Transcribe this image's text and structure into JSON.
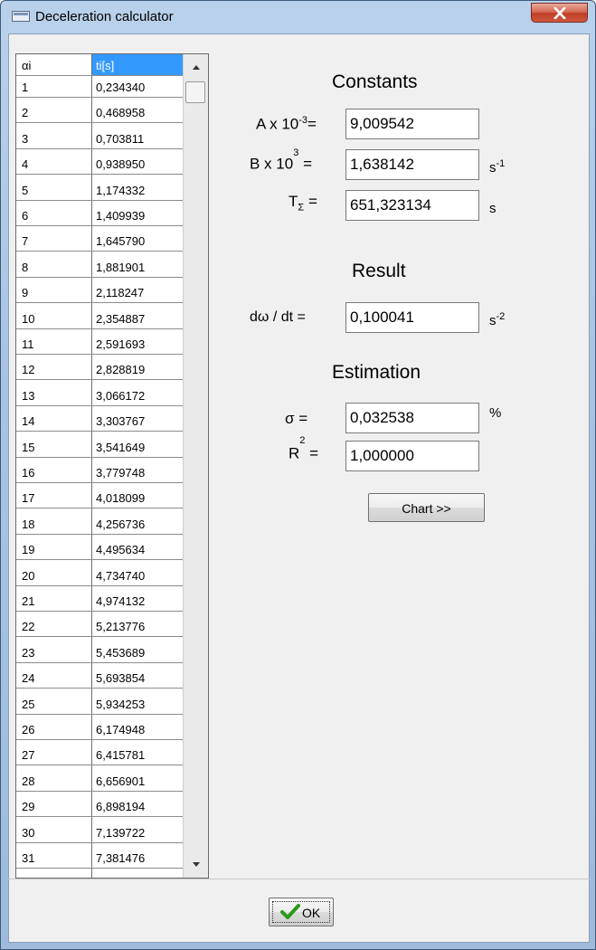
{
  "window": {
    "title": "Deceleration calculator",
    "close_glyph": "x",
    "icon": "app-window-icon"
  },
  "table": {
    "headers": [
      "αi",
      "ti[s]"
    ],
    "rows": [
      [
        "1",
        "0,234340"
      ],
      [
        "2",
        "0,468958"
      ],
      [
        "3",
        "0,703811"
      ],
      [
        "4",
        "0,938950"
      ],
      [
        "5",
        "1,174332"
      ],
      [
        "6",
        "1,409939"
      ],
      [
        "7",
        "1,645790"
      ],
      [
        "8",
        "1,881901"
      ],
      [
        "9",
        "2,118247"
      ],
      [
        "10",
        "2,354887"
      ],
      [
        "11",
        "2,591693"
      ],
      [
        "12",
        "2,828819"
      ],
      [
        "13",
        "3,066172"
      ],
      [
        "14",
        "3,303767"
      ],
      [
        "15",
        "3,541649"
      ],
      [
        "16",
        "3,779748"
      ],
      [
        "17",
        "4,018099"
      ],
      [
        "18",
        "4,256736"
      ],
      [
        "19",
        "4,495634"
      ],
      [
        "20",
        "4,734740"
      ],
      [
        "21",
        "4,974132"
      ],
      [
        "22",
        "5,213776"
      ],
      [
        "23",
        "5,453689"
      ],
      [
        "24",
        "5,693854"
      ],
      [
        "25",
        "5,934253"
      ],
      [
        "26",
        "6,174948"
      ],
      [
        "27",
        "6,415781"
      ],
      [
        "28",
        "6,656901"
      ],
      [
        "29",
        "6,898194"
      ],
      [
        "30",
        "7,139722"
      ],
      [
        "31",
        "7,381476"
      ]
    ]
  },
  "constants": {
    "heading": "Constants",
    "a_label": "A x 10",
    "a_exp": "-3",
    "a_eq": "=",
    "a_value": "9,009542",
    "b_label": "B x 10",
    "b_exp": "3",
    "b_eq": "=",
    "b_value": "1,638142",
    "b_unit": "s",
    "b_unit_exp": "-1",
    "t_label": "T",
    "t_sub": "Σ",
    "t_eq": "=",
    "t_value": "651,323134",
    "t_unit": "s"
  },
  "result": {
    "heading": "Result",
    "label": "dω / dt  =",
    "value": "0,100041",
    "unit": "s",
    "unit_exp": "-2"
  },
  "estimation": {
    "heading": "Estimation",
    "sigma_label": "σ  =",
    "sigma_value": "0,032538",
    "sigma_unit": "%",
    "r_label": "R",
    "r_exp": "2",
    "r_eq": "=",
    "r_value": "1,000000"
  },
  "buttons": {
    "chart": "Chart >>",
    "ok": "OK"
  },
  "colors": {
    "selection": "#3399ff",
    "close": "#c03f27",
    "check": "#2a9a1a"
  }
}
